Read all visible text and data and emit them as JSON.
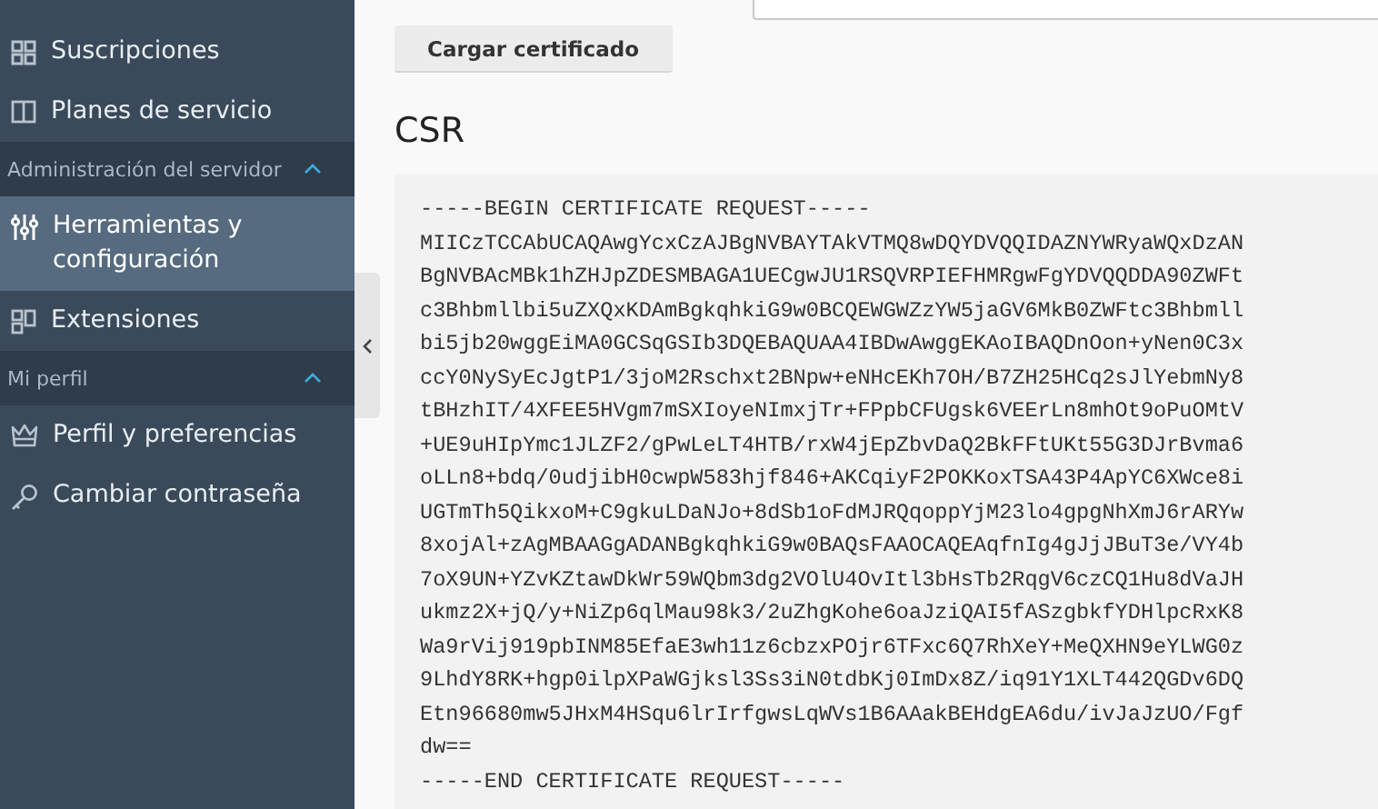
{
  "sidebar": {
    "items": [
      {
        "kind": "item",
        "label": "Suscripciones",
        "selected": false
      },
      {
        "kind": "item",
        "label": "Planes de servicio",
        "selected": false
      },
      {
        "kind": "section",
        "label": "Administración del servidor",
        "expanded": true
      },
      {
        "kind": "item",
        "label": "Herramientas y configuración",
        "selected": true
      },
      {
        "kind": "item",
        "label": "Extensiones",
        "selected": false
      },
      {
        "kind": "section",
        "label": "Mi perfil",
        "expanded": true
      },
      {
        "kind": "item",
        "label": "Perfil y preferencias",
        "selected": false
      },
      {
        "kind": "item",
        "label": "Cambiar contraseña",
        "selected": false
      }
    ]
  },
  "upload_button": "Cargar certificado",
  "csr": {
    "title": "CSR",
    "lines": [
      "-----BEGIN CERTIFICATE REQUEST-----",
      "MIICzTCCAbUCAQAwgYcxCzAJBgNVBAYTAkVTMQ8wDQYDVQQIDAZNYWRyaWQxDzAN",
      "BgNVBAcMBk1hZHJpZDESMBAGA1UECgwJU1RSQVRPIEFHMRgwFgYDVQQDDA90ZWFt",
      "c3Bhbmllbi5uZXQxKDAmBgkqhkiG9w0BCQEWGWZzYW5jaGV6MkB0ZWFtc3Bhbmll",
      "bi5jb20wggEiMA0GCSqGSIb3DQEBAQUAA4IBDwAwggEKAoIBAQDnOon+yNen0C3x",
      "ccY0NySyEcJgtP1/3joM2Rschxt2BNpw+eNHcEKh7OH/B7ZH25HCq2sJlYebmNy8",
      "tBHzhIT/4XFEE5HVgm7mSXIoyeNImxjTr+FPpbCFUgsk6VEErLn8mhOt9oPuOMtV",
      "+UE9uHIpYmc1JLZF2/gPwLeLT4HTB/rxW4jEpZbvDaQ2BkFFtUKt55G3DJrBvma6",
      "oLLn8+bdq/0udjibH0cwpW583hjf846+AKCqiyF2POKKoxTSA43P4ApYC6XWce8i",
      "UGTmTh5QikxoM+C9gkuLDaNJo+8dSb1oFdMJRQqoppYjM23lo4gpgNhXmJ6rARYw",
      "8xojAl+zAgMBAAGgADANBgkqhkiG9w0BAQsFAAOCAQEAqfnIg4gJjJBuT3e/VY4b",
      "7oX9UN+YZvKZtawDkWr59WQbm3dg2VOlU4OvItl3bHsTb2RqgV6czCQ1Hu8dVaJH",
      "ukmz2X+jQ/y+NiZp6qlMau98k3/2uZhgKohe6oaJziQAI5fASzgbkfYDHlpcRxK8",
      "Wa9rVij919pbINM85EfaE3wh11z6cbzxPOjr6TFxc6Q7RhXeY+MeQXHN9eYLWG0z",
      "9LhdY8RK+hgp0ilpXPaWGjksl3Ss3iN0tdbKj0ImDx8Z/iq91Y1XLT442QGDv6DQ",
      "Etn96680mw5JHxM4HSqu6lrIrfgwsLqWVs1B6AAakBEHdgEA6du/ivJaJzUO/Fgf",
      "dw==",
      "-----END CERTIFICATE REQUEST-----"
    ]
  }
}
